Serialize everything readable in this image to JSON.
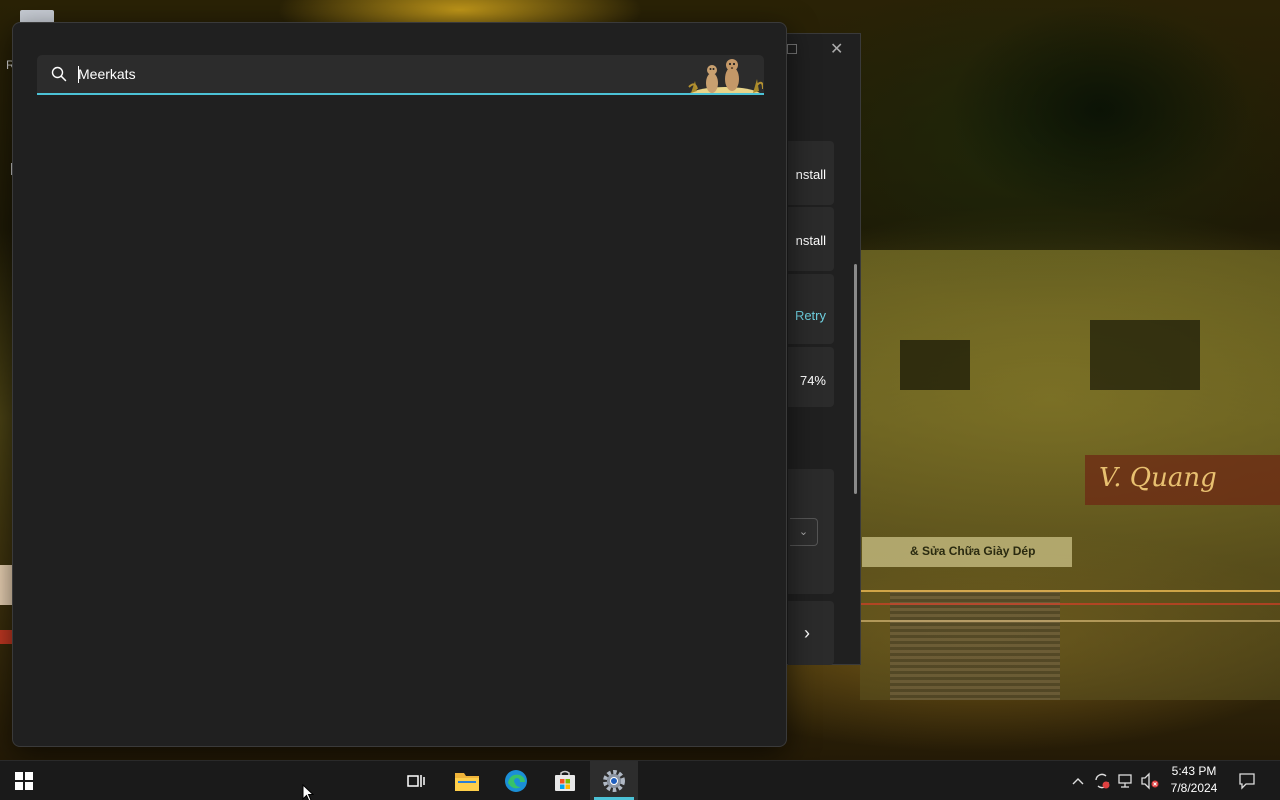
{
  "search": {
    "value": "Meerkats",
    "placeholder": "",
    "accent_color": "#4cc2d6"
  },
  "background_window": {
    "items": [
      {
        "label": "nstall"
      },
      {
        "label": "nstall"
      },
      {
        "label": "Retry"
      },
      {
        "label": "74%"
      }
    ]
  },
  "wallpaper": {
    "shop_sign": "V. Quang",
    "shop_sign_2": "& Sửa Chữa Giày Dép"
  },
  "desktop": {
    "partial_label": "R"
  },
  "taskbar": {
    "apps": [
      {
        "icon": "windows-start-icon"
      },
      {
        "icon": "task-view-icon"
      },
      {
        "icon": "file-explorer-icon"
      },
      {
        "icon": "edge-icon"
      },
      {
        "icon": "microsoft-store-icon"
      },
      {
        "icon": "settings-icon",
        "active": true
      }
    ],
    "tray": [
      "chevron-up-icon",
      "sync-icon",
      "network-icon",
      "volume-muted-icon"
    ],
    "time": "5:43 PM",
    "date": "7/8/2024"
  }
}
